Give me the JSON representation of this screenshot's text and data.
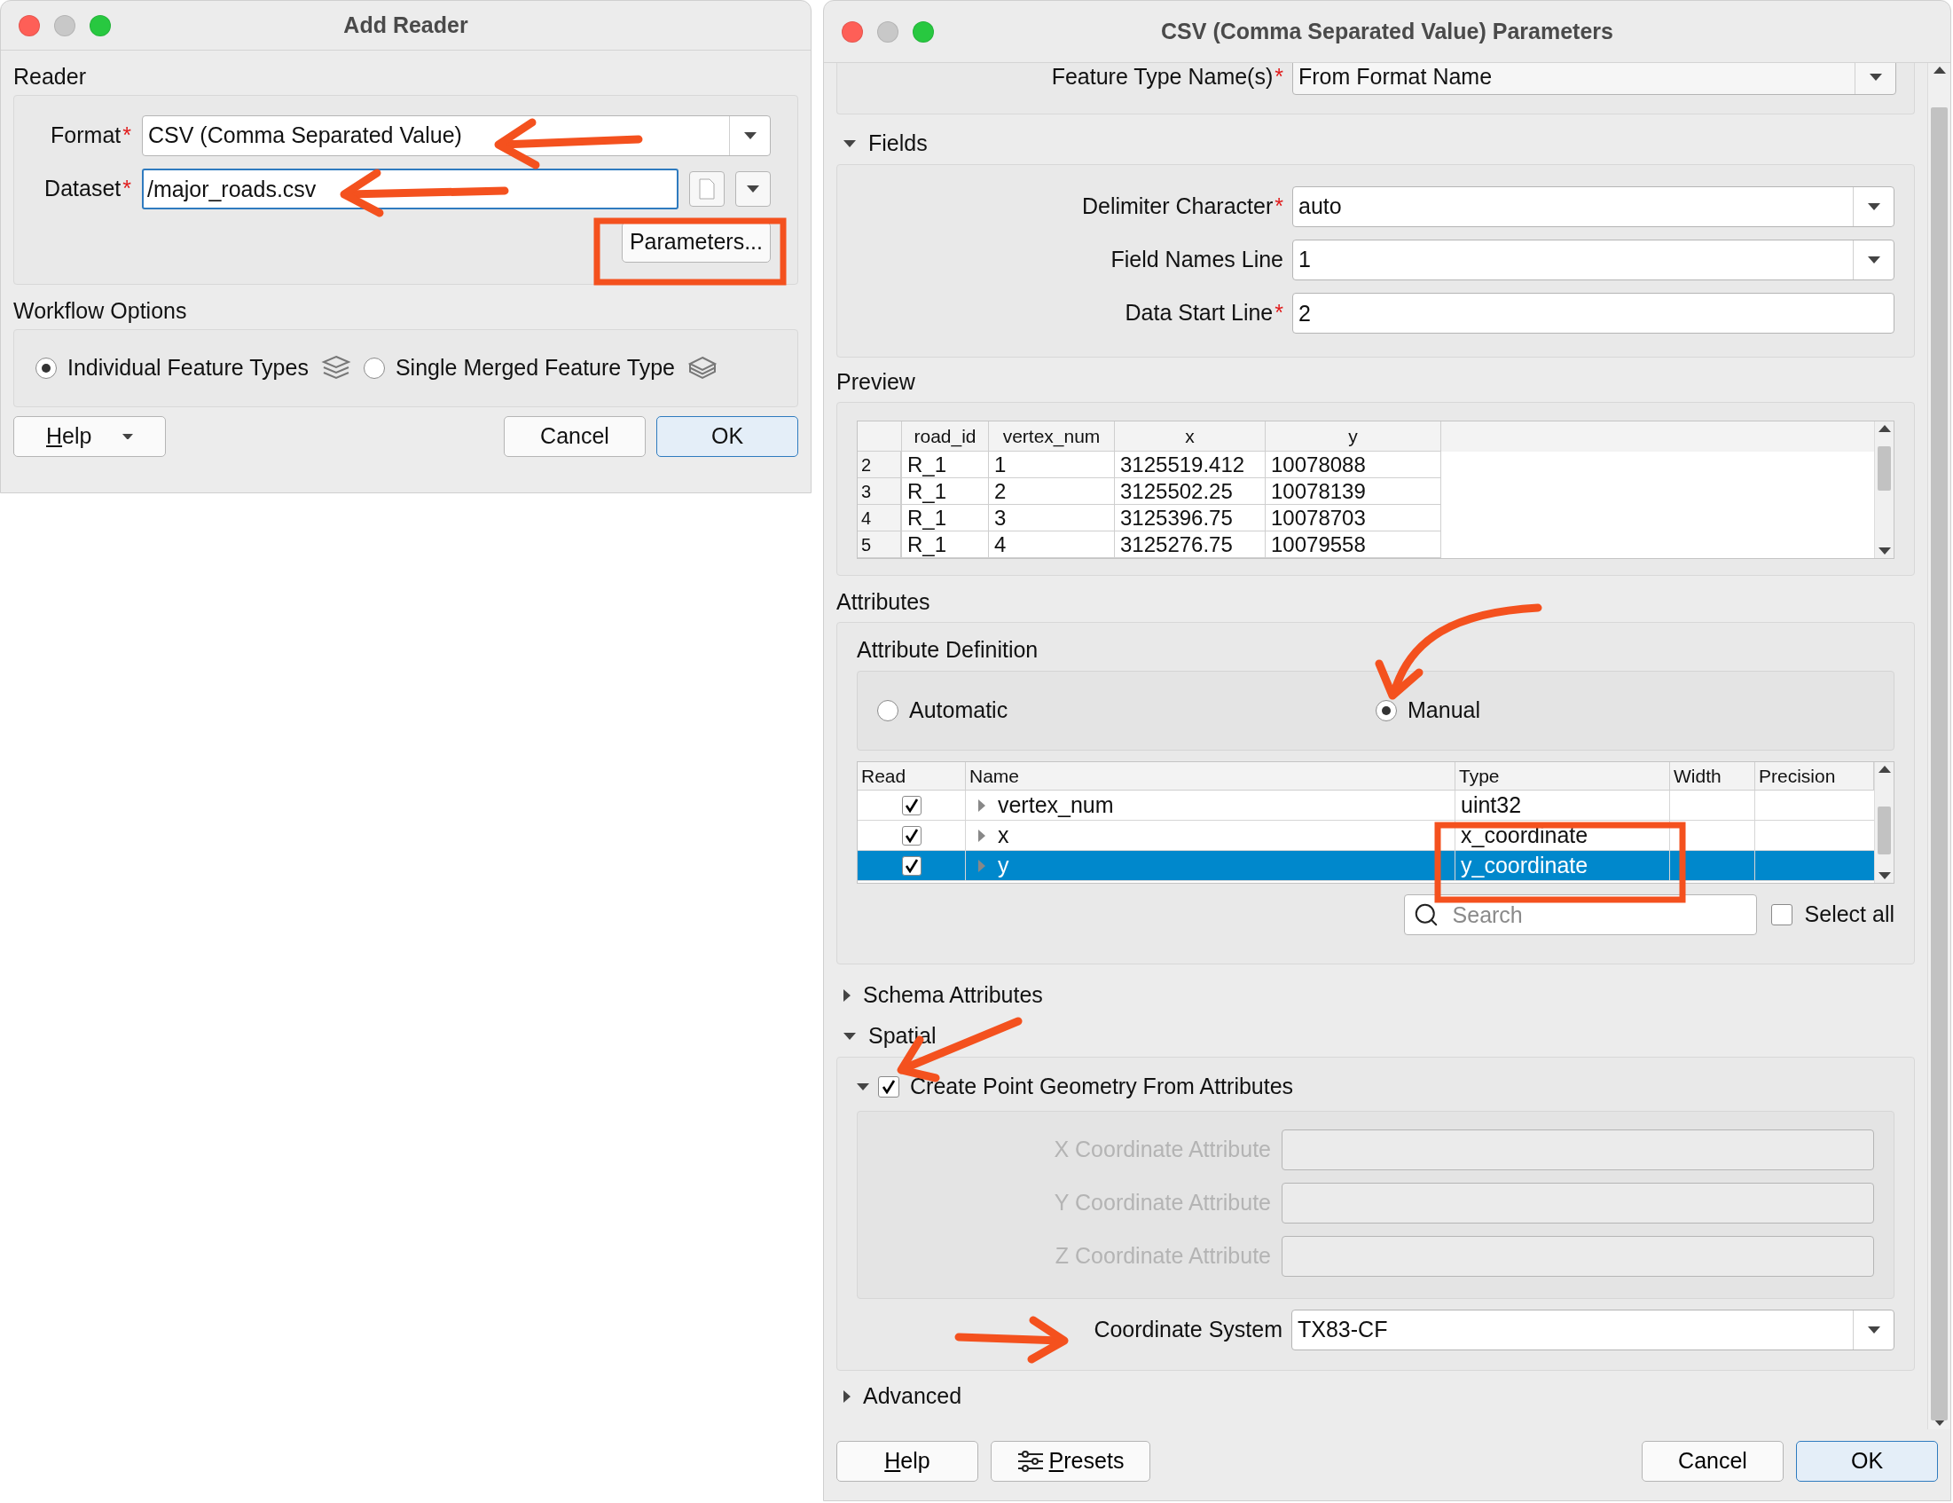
{
  "add_reader": {
    "title": "Add Reader",
    "reader_label": "Reader",
    "format": {
      "label": "Format",
      "required_mark": "*",
      "value": "CSV (Comma Separated Value)"
    },
    "dataset": {
      "label": "Dataset",
      "required_mark": "*",
      "value": "/major_roads.csv"
    },
    "parameters_button": "Parameters...",
    "workflow_label": "Workflow Options",
    "workflow_options": [
      {
        "label": "Individual Feature Types",
        "selected": true
      },
      {
        "label": "Single Merged Feature Type",
        "selected": false
      }
    ],
    "help_button": "Help",
    "cancel_button": "Cancel",
    "ok_button": "OK"
  },
  "csv_parameters": {
    "title": "CSV (Comma Separated Value) Parameters",
    "feature_type": {
      "label": "Feature Type Name(s)",
      "required_mark": "*",
      "value": "From Format Name"
    },
    "fields": {
      "title": "Fields",
      "expanded": true,
      "rows": [
        {
          "kind": "dropdown",
          "label": "Delimiter Character",
          "required_mark": "*",
          "value": "auto"
        },
        {
          "kind": "dropdown",
          "label": "Field Names Line",
          "value": "1"
        },
        {
          "kind": "text",
          "label": "Data Start Line",
          "required_mark": "*",
          "value": "2"
        }
      ]
    },
    "preview": {
      "title": "Preview",
      "columns": [
        "road_id",
        "vertex_num",
        "x",
        "y"
      ],
      "rows": [
        {
          "number": "2",
          "cells": [
            "R_1",
            "1",
            "3125519.412",
            "10078088"
          ]
        },
        {
          "number": "3",
          "cells": [
            "R_1",
            "2",
            "3125502.25",
            "10078139"
          ]
        },
        {
          "number": "4",
          "cells": [
            "R_1",
            "3",
            "3125396.75",
            "10078703"
          ]
        },
        {
          "number": "5",
          "cells": [
            "R_1",
            "4",
            "3125276.75",
            "10079558"
          ]
        }
      ]
    },
    "attributes": {
      "title": "Attributes",
      "definition_label": "Attribute Definition",
      "definition_options": [
        {
          "label": "Automatic",
          "selected": false
        },
        {
          "label": "Manual",
          "selected": true
        }
      ],
      "columns": [
        "Read",
        "Name",
        "Type",
        "Width",
        "Precision"
      ],
      "rows": [
        {
          "read": true,
          "name": "vertex_num",
          "type": "uint32",
          "selected": false
        },
        {
          "read": true,
          "name": "x",
          "type": "x_coordinate",
          "selected": false
        },
        {
          "read": true,
          "name": "y",
          "type": "y_coordinate",
          "selected": true
        }
      ],
      "search": {
        "placeholder": "Search"
      },
      "select_all": {
        "label": "Select all",
        "checked": false
      }
    },
    "schema_attributes": {
      "title": "Schema Attributes",
      "expanded": false
    },
    "spatial": {
      "title": "Spatial",
      "expanded": true,
      "create_point": {
        "label": "Create Point Geometry From Attributes",
        "checked": true,
        "expanded": true
      },
      "coordinate_fields": [
        {
          "label": "X Coordinate Attribute",
          "disabled": true
        },
        {
          "label": "Y Coordinate Attribute",
          "disabled": true
        },
        {
          "label": "Z Coordinate Attribute",
          "disabled": true
        }
      ],
      "coordinate_system": {
        "label": "Coordinate System",
        "value": "TX83-CF"
      }
    },
    "advanced": {
      "title": "Advanced",
      "expanded": false
    },
    "help_button": "Help",
    "presets_button": "Presets",
    "cancel_button": "Cancel",
    "ok_button": "OK"
  }
}
